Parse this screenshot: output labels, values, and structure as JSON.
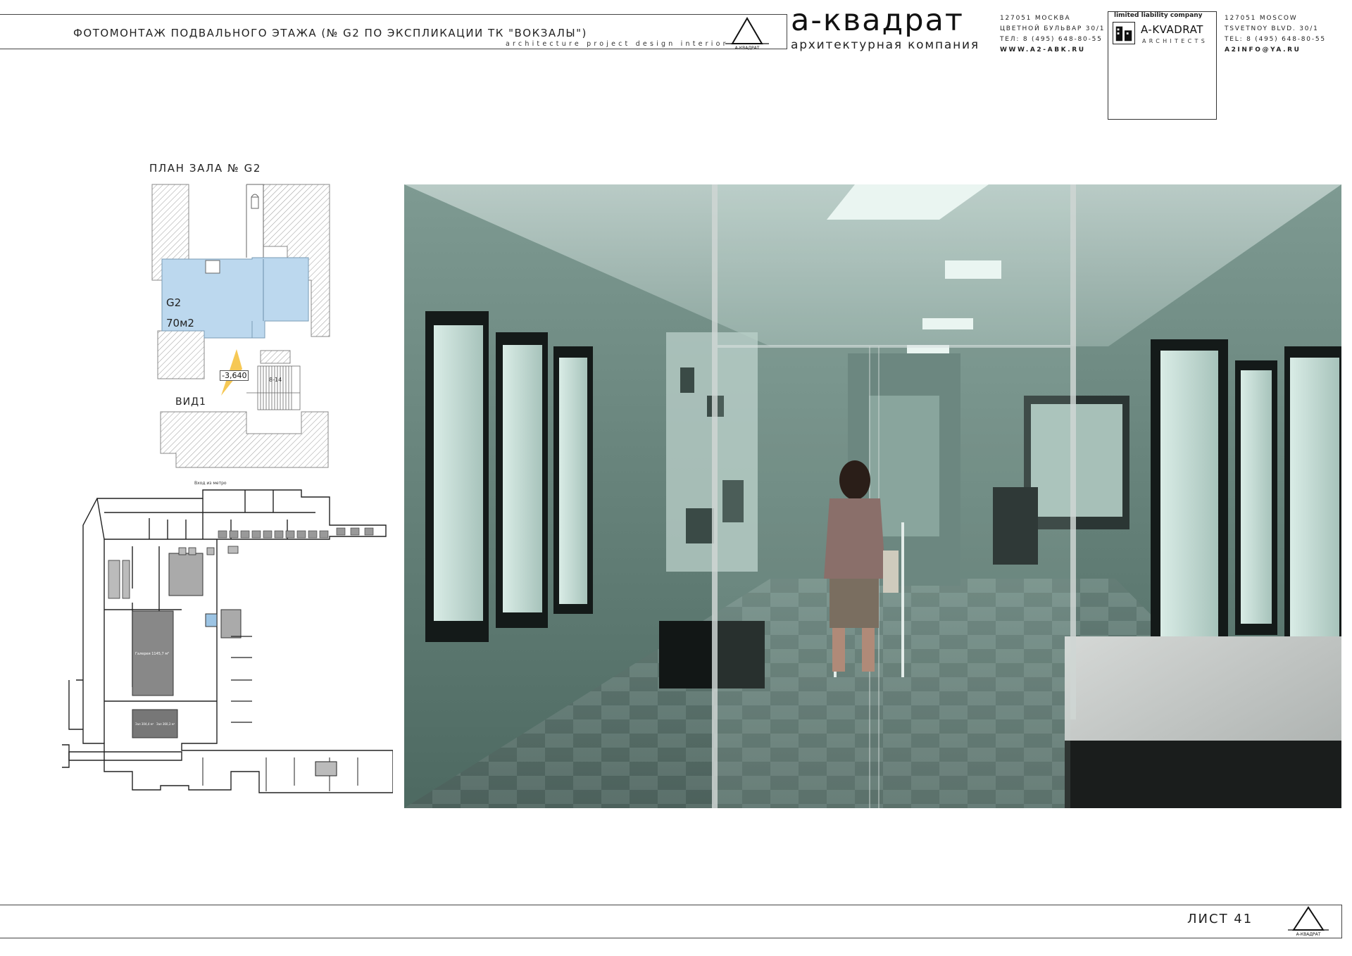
{
  "header": {
    "title": "ФОТОМОНТАЖ  ПОДВАЛЬНОГО ЭТАЖА  (№ G2 ПО ЭКСПЛИКАЦИИ ТК \"ВОКЗАЛЫ\")",
    "subtitle": "architecture   project   design   interior",
    "logo_text": "А-КВАДРАТ",
    "brand_name": "а-квадрат",
    "brand_tagline": "архитектурная компания",
    "ru_contact": {
      "postcode_city": "127051 МОСКВА",
      "address": "ЦВЕТНОЙ БУЛЬВАР 30/1",
      "phone": "ТЕЛ: 8 (495) 648-80-55",
      "website": "WWW.A2-ABK.RU"
    },
    "en_contact": {
      "postcode_city": "127051 MOSCOW",
      "address": "TSVETNOY BLVD. 30/1",
      "phone": "TEL: 8 (495) 648-80-55",
      "email": "A2INFO@YA.RU"
    },
    "llc": {
      "label": "limited liability company",
      "name": "A-KVADRAT",
      "sub": "ARCHITECTS"
    }
  },
  "plan": {
    "title": "ПЛАН ЗАЛА № G2",
    "hall_name": "G2",
    "hall_area": "70м2",
    "level": "-3,640",
    "view_label": "ВИД1",
    "stair_label": "8-14",
    "highlight_color": "#bcd8ee",
    "view_cone_color": "#f5c242"
  },
  "site_plan": {
    "entrance_label": "Вход из метро",
    "hall_label": "Галерея 1145,7 м²",
    "room_labels": [
      "Зал 304,4 м²",
      "Зал 360,3 м²"
    ]
  },
  "montage": {
    "tone": "#6f8f86",
    "icons": [
      "showcase-icon",
      "ceiling-light-icon",
      "glass-door-icon",
      "visitor-icon"
    ]
  },
  "footer": {
    "sheet_label": "ЛИСТ 41",
    "logo_text": "А-КВАДРАТ"
  }
}
